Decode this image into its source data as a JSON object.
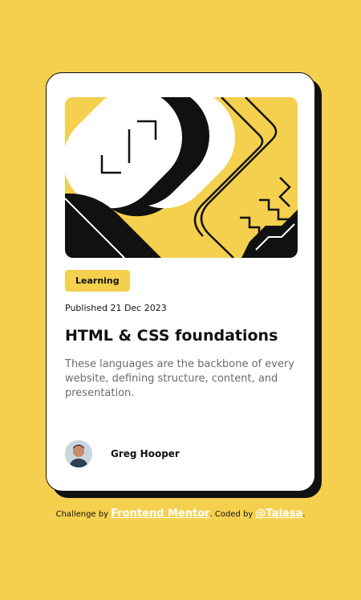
{
  "card": {
    "tag": "Learning",
    "published": "Published 21 Dec 2023",
    "title": "HTML & CSS foundations",
    "description": "These languages are the backbone of every website, defining structure, content, and presentation.",
    "author": "Greg Hooper"
  },
  "attribution": {
    "prefix": "Challenge by",
    "link1": "Frontend Mentor",
    "middle": ". Coded by",
    "link2": "@Talasa",
    "suffix": "."
  },
  "colors": {
    "background": "#f4d04e",
    "card": "#ffffff",
    "ink": "#111111",
    "muted": "#6b6b6b"
  },
  "icons": {
    "illustration": "abstract-shapes-illustration",
    "avatar": "author-avatar"
  }
}
